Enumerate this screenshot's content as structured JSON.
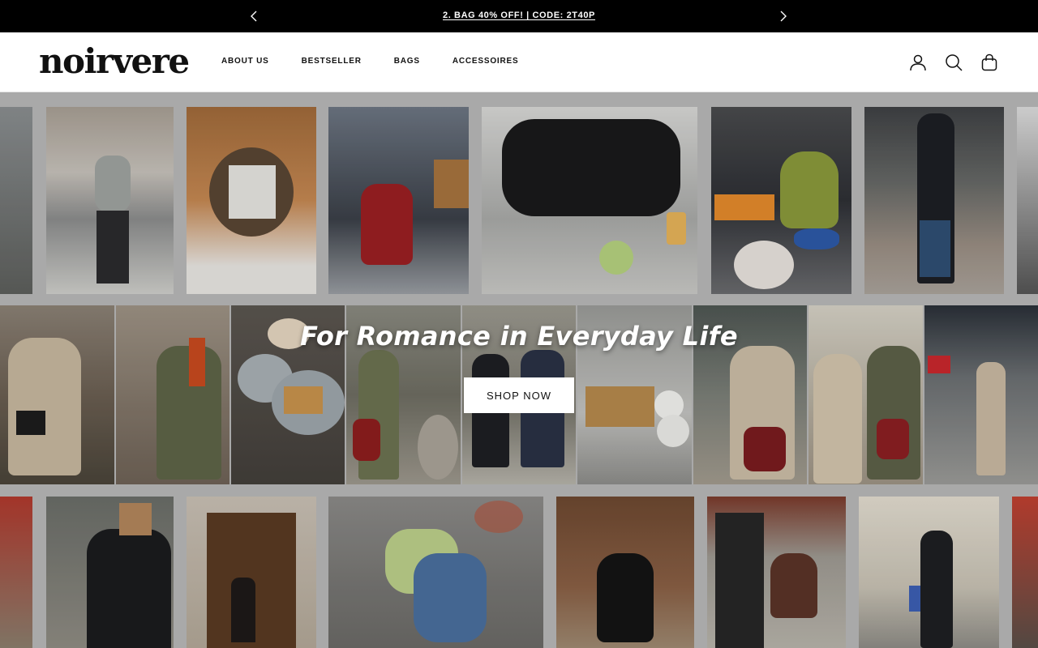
{
  "announcement": {
    "message": "2. BAG 40% OFF! | CODE: 2T40P",
    "prev_icon": "chevron-left-icon",
    "next_icon": "chevron-right-icon"
  },
  "header": {
    "logo": "noirvere",
    "nav": [
      {
        "label": "ABOUT US"
      },
      {
        "label": "BESTSELLER"
      },
      {
        "label": "BAGS"
      },
      {
        "label": "ACCESSOIRES"
      }
    ],
    "icons": [
      "account-icon",
      "search-icon",
      "cart-icon"
    ]
  },
  "hero": {
    "title": "For Romance in Everyday Life",
    "cta_label": "SHOP NOW"
  },
  "colors": {
    "announcement_bg": "#000000",
    "text": "#111111",
    "hero_gap": "#b8b8b8",
    "button_bg": "#ffffff"
  }
}
